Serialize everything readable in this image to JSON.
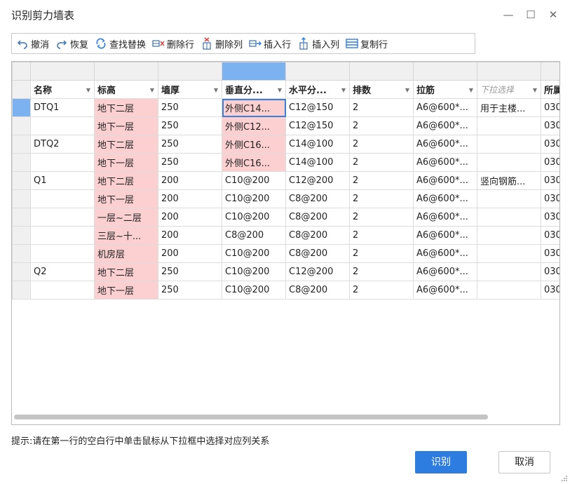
{
  "window": {
    "title": "识别剪力墙表",
    "minimize": "—",
    "maximize": "☐",
    "close": "✕"
  },
  "toolbar": {
    "undo": "撤消",
    "redo": "恢复",
    "find_replace": "查找替换",
    "delete_row": "删除行",
    "delete_col": "删除列",
    "insert_row": "插入行",
    "insert_col": "插入列",
    "copy_row": "复制行"
  },
  "grid": {
    "headers": [
      "名称",
      "标高",
      "墙厚",
      "垂直分...",
      "水平分...",
      "排数",
      "拉筋",
      "下拉选择",
      "所属"
    ],
    "rows": [
      [
        "DTQ1",
        "地下二层",
        "250",
        "外侧C14...",
        "C12@150",
        "2",
        "A6@600*...",
        "用于主楼...",
        "030"
      ],
      [
        "",
        "地下一层",
        "250",
        "外侧C12...",
        "C12@150",
        "2",
        "A6@600*...",
        "",
        "030"
      ],
      [
        "DTQ2",
        "地下二层",
        "250",
        "外侧C16...",
        "C14@100",
        "2",
        "A6@600*...",
        "",
        "030"
      ],
      [
        "",
        "地下一层",
        "250",
        "外侧C16...",
        "C14@100",
        "2",
        "A6@600*...",
        "",
        "030"
      ],
      [
        "Q1",
        "地下二层",
        "200",
        "C10@200",
        "C12@200",
        "2",
        "A6@600*...",
        "竖向钢筋...",
        "030"
      ],
      [
        "",
        "地下一层",
        "200",
        "C10@200",
        "C8@200",
        "2",
        "A6@600*...",
        "",
        "030"
      ],
      [
        "",
        "一层~二层",
        "200",
        "C10@200",
        "C8@200",
        "2",
        "A6@600*...",
        "",
        "030"
      ],
      [
        "",
        "三层~十...",
        "200",
        "C8@200",
        "C8@200",
        "2",
        "A6@600*...",
        "",
        "030"
      ],
      [
        "",
        "机房层",
        "200",
        "C10@200",
        "C8@200",
        "2",
        "A6@600*...",
        "",
        "030"
      ],
      [
        "Q2",
        "地下二层",
        "250",
        "C10@200",
        "C12@200",
        "2",
        "A6@600*...",
        "",
        "030"
      ],
      [
        "",
        "地下一层",
        "250",
        "C10@200",
        "C8@200",
        "2",
        "A6@600*...",
        "",
        "030"
      ]
    ]
  },
  "hint": "提示:请在第一行的空白行中单击鼠标从下拉框中选择对应列关系",
  "buttons": {
    "ok": "识别",
    "cancel": "取消"
  },
  "colors": {
    "accent": "#2d7de0",
    "selected_header": "#7cb2ef",
    "highlight_pink": "#fcd0d0"
  }
}
